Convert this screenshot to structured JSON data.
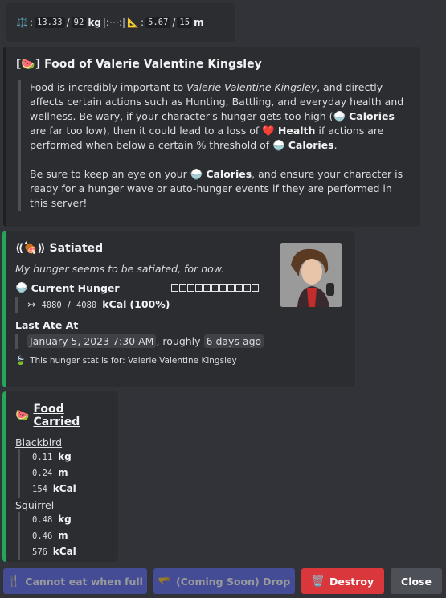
{
  "stats": {
    "weight_icon": "⚖️",
    "weight_current": "13.33",
    "weight_max": "92",
    "weight_unit": "kg",
    "divider": "|:⋯:|",
    "height_icon": "📐",
    "height_current": "5.67",
    "height_max": "15",
    "height_unit": "m"
  },
  "food_info": {
    "title": "Food of Valerie Valentine Kingsley",
    "p1_a": "Food is incredibly important to ",
    "p1_name": "Valerie Valentine Kingsley",
    "p1_b": ", and directly affects certain actions such as Hunting, Battling, and everyday health and wellness. Be wary, if your character's hunger gets too high (",
    "calories": "Calories",
    "p1_c": " are far too low), then it could lead to a loss of ",
    "health": "Health",
    "p1_d": " if actions are performed when below a certain % threshold of ",
    "p1_e": ".",
    "p2_a": "Be sure to keep an eye on your ",
    "p2_b": ", and ensure your character is ready for a hunger wave or auto-hunger events if they are performed in this server!"
  },
  "hunger": {
    "title": "Satiated",
    "subtitle": "My hunger seems to be satiated, for now.",
    "current_label": "Current Hunger",
    "bar_segments": 11,
    "bar_filled_fraction": 0,
    "arrow": "↣",
    "current_value": "4080",
    "max_value": "4080",
    "unit": "kCal",
    "percent": "(100%)",
    "last_ate_label": "Last Ate At",
    "last_ate_date": "January 5, 2023 7:30 AM",
    "last_ate_sep": ", roughly ",
    "last_ate_rel": "6 days ago",
    "footer": "This hunger stat is for: Valerie Valentine Kingsley"
  },
  "carried": {
    "title": "Food Carried",
    "items": [
      {
        "name": "Blackbird",
        "weight": "0.11",
        "weight_unit": "kg",
        "length": "0.24",
        "length_unit": "m",
        "kcal": "154",
        "kcal_unit": "kCal"
      },
      {
        "name": "Squirrel",
        "weight": "0.48",
        "weight_unit": "kg",
        "length": "0.46",
        "length_unit": "m",
        "kcal": "576",
        "kcal_unit": "kCal"
      }
    ]
  },
  "buttons": {
    "eat": "Cannot eat when full",
    "drop": "(Coming Soon) Drop",
    "destroy": "Destroy",
    "close": "Close"
  },
  "colors": {
    "accent_green": "#23a55a",
    "destroy_red": "#da373c",
    "blurple": "#5865f2",
    "close_grey": "#4e5058"
  }
}
